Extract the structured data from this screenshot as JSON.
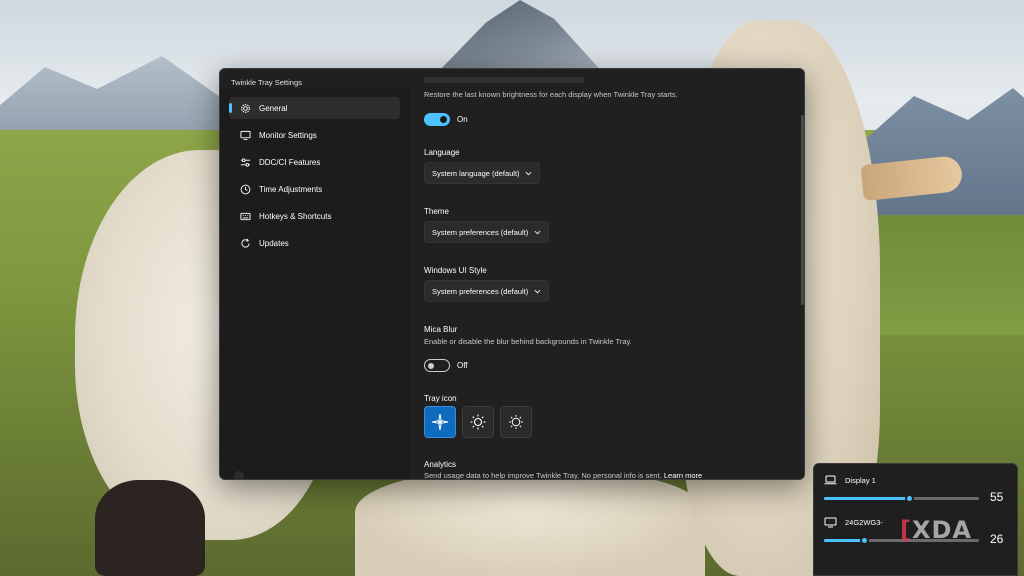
{
  "window": {
    "title": "Twinkle Tray Settings",
    "controls": {
      "minimize": "—",
      "maximize": "☐",
      "close": "✕"
    }
  },
  "sidebar": {
    "items": [
      {
        "label": "General",
        "icon": "gear-icon",
        "active": true
      },
      {
        "label": "Monitor Settings",
        "icon": "monitor-icon",
        "active": false
      },
      {
        "label": "DDC/CI Features",
        "icon": "sliders-icon",
        "active": false
      },
      {
        "label": "Time Adjustments",
        "icon": "clock-icon",
        "active": false
      },
      {
        "label": "Hotkeys & Shortcuts",
        "icon": "keyboard-icon",
        "active": false
      },
      {
        "label": "Updates",
        "icon": "refresh-icon",
        "active": false
      }
    ]
  },
  "general": {
    "restore_brightness": {
      "description": "Restore the last known brightness for each display when Twinkle Tray starts.",
      "state": "On"
    },
    "language": {
      "label": "Language",
      "value": "System language (default)"
    },
    "theme": {
      "label": "Theme",
      "value": "System preferences (default)"
    },
    "windows_ui_style": {
      "label": "Windows UI Style",
      "value": "System preferences (default)"
    },
    "mica_blur": {
      "label": "Mica Blur",
      "description": "Enable or disable the blur behind backgrounds in Twinkle Tray.",
      "state": "Off"
    },
    "tray_icon": {
      "label": "Tray icon",
      "options": [
        "sparkle-sun-icon",
        "sun-icon",
        "sun-outline-icon"
      ],
      "selected_index": 0
    },
    "analytics": {
      "label": "Analytics",
      "description": "Send usage data to help improve Twinkle Tray. No personal info is sent.",
      "link": "Learn more"
    }
  },
  "flyout": {
    "displays": [
      {
        "name": "Display 1",
        "icon": "laptop-icon",
        "brightness": 55
      },
      {
        "name": "24G2WG3-",
        "icon": "monitor-icon",
        "brightness": 26
      }
    ],
    "accent": "#4cc2ff"
  },
  "watermark": {
    "bracket": "[",
    "text": "XDA"
  },
  "colors": {
    "accent": "#4cc2ff",
    "tray_selected": "#0f6cbd",
    "window_bg": "#202020"
  }
}
